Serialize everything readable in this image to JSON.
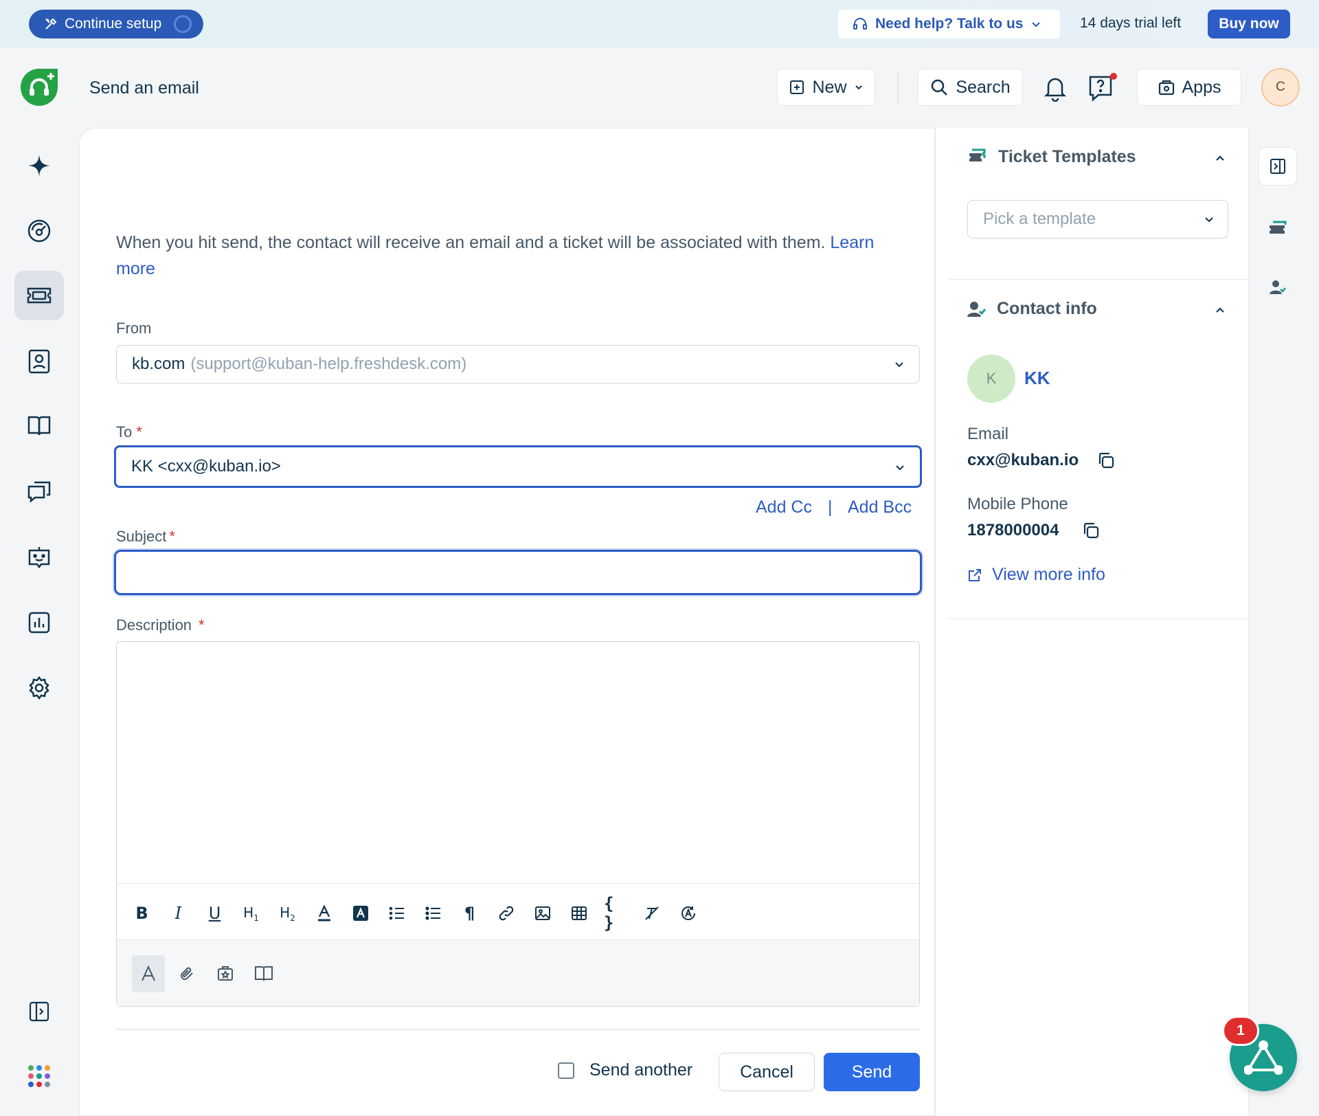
{
  "banner": {
    "continue_setup": "Continue setup",
    "help": "Need help? Talk to us",
    "trial": "14 days trial left",
    "buy_now": "Buy now"
  },
  "header": {
    "title": "Send an email",
    "new_label": "New",
    "search_label": "Search",
    "apps_label": "Apps",
    "avatar_initial": "C"
  },
  "leftnav": {
    "items": [
      "sparkle",
      "dashboard",
      "tickets",
      "contacts",
      "knowledge-base",
      "conversations",
      "bot",
      "analytics",
      "settings"
    ],
    "active": "tickets"
  },
  "form": {
    "intro_text": "When you hit send, the contact will receive an email and a ticket will be associated with them. ",
    "intro_link": "Learn more",
    "from_label": "From",
    "from_value": "kb.com",
    "from_address": "(support@kuban-help.freshdesk.com)",
    "to_label": "To",
    "to_value": "KK <cxx@kuban.io>",
    "add_cc": "Add Cc",
    "separator": "|",
    "add_bcc": "Add Bcc",
    "subject_label": "Subject",
    "subject_value": "",
    "description_label": "Description",
    "required_mark": "*",
    "send_another": "Send another",
    "cancel": "Cancel",
    "send": "Send"
  },
  "right_panel": {
    "templates_title": "Ticket Templates",
    "template_placeholder": "Pick a template",
    "contact_title": "Contact info",
    "contact_initial": "K",
    "contact_name": "KK",
    "email_label": "Email",
    "email_value": "cxx@kuban.io",
    "phone_label": "Mobile Phone",
    "phone_value": "1878000004",
    "view_more": "View more info"
  },
  "widget": {
    "badge_count": "1"
  },
  "colors": {
    "primary": "#2c5cc5",
    "send_button": "#2c6ce8",
    "logo_green": "#25a244",
    "widget_teal": "#1a9d8c",
    "required": "#d72d30"
  }
}
